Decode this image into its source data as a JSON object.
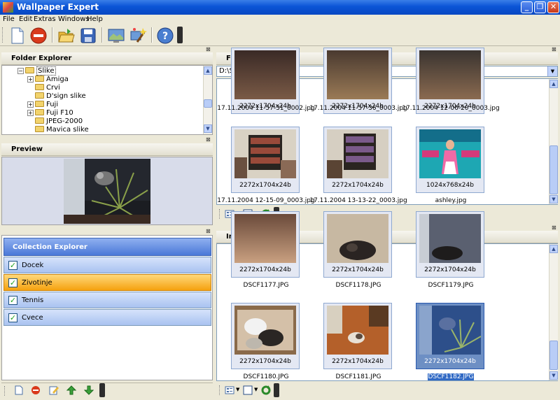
{
  "window": {
    "title": "Wallpaper Expert",
    "controls": [
      "_",
      "❐",
      "✕"
    ]
  },
  "menu": [
    "File",
    "Edit",
    "Extras",
    "Windows",
    "Help"
  ],
  "toolbar": {
    "items": [
      "new-document",
      "stop",
      "open-folder",
      "save",
      "desktop-preview",
      "wizard",
      "help"
    ]
  },
  "folder_explorer": {
    "title": "Folder Explorer",
    "items": [
      {
        "label": "Slike",
        "expander": "⊖",
        "level": 0
      },
      {
        "label": "Amiga",
        "expander": "⊞",
        "level": 1
      },
      {
        "label": "Crvi",
        "expander": "",
        "level": 1
      },
      {
        "label": "D'sign slike",
        "expander": "",
        "level": 1
      },
      {
        "label": "Fuji",
        "expander": "⊞",
        "level": 1
      },
      {
        "label": "Fuji F10",
        "expander": "⊞",
        "level": 1
      },
      {
        "label": "JPEG-2000",
        "expander": "",
        "level": 1
      },
      {
        "label": "Mavica slike",
        "expander": "",
        "level": 1
      }
    ]
  },
  "preview": {
    "title": "Preview"
  },
  "collection_explorer": {
    "title": "Collection Explorer",
    "items": [
      {
        "label": "Docek",
        "active": false
      },
      {
        "label": "Zivotinje",
        "active": true
      },
      {
        "label": "Tennis",
        "active": false
      },
      {
        "label": "Cvece",
        "active": false
      }
    ]
  },
  "file_explorer": {
    "title": "File Explorer",
    "path": "D:\\Slike",
    "items": [
      {
        "res": "2272x1704x24b",
        "name": "17.11.2004 11-57-31_0002.jpg"
      },
      {
        "res": "2272x1704x24b",
        "name": "17.11.2004 11-57-36_0003.jpg"
      },
      {
        "res": "2272x1704x24b",
        "name": "17.11.2004 12-06-20_0003.jpg"
      },
      {
        "res": "2272x1704x24b",
        "name": "17.11.2004 12-15-09_0003.jpg"
      },
      {
        "res": "2272x1704x24b",
        "name": "17.11.2004 13-13-22_0003.jpg"
      },
      {
        "res": "1024x768x24b",
        "name": "ashley.jpg"
      }
    ]
  },
  "image_explorer": {
    "title": "Image Explorer",
    "items": [
      {
        "res": "2272x1704x24b",
        "name": "DSCF1177.JPG"
      },
      {
        "res": "2272x1704x24b",
        "name": "DSCF1178.JPG"
      },
      {
        "res": "2272x1704x24b",
        "name": "DSCF1179.JPG"
      },
      {
        "res": "2272x1704x24b",
        "name": "DSCF1180.JPG"
      },
      {
        "res": "2272x1704x24b",
        "name": "DSCF1181.JPG"
      },
      {
        "res": "2272x1704x24b",
        "name": "DSCF1182.JPG",
        "selected": true
      }
    ]
  },
  "colors": {
    "titlebar": "#0a54d6",
    "selection": "#316ac5",
    "active_collection": "#f5a10f",
    "collection_item": "#a9c2f0"
  }
}
